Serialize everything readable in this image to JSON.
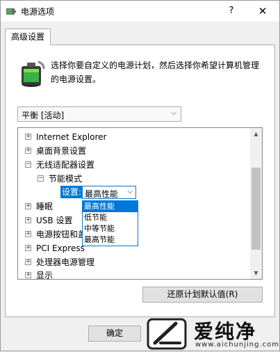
{
  "window": {
    "title": "电源选项",
    "help_label": "?",
    "close_label": "✕",
    "icon": "power-options-icon"
  },
  "tab": {
    "label": "高级设置"
  },
  "description": {
    "line1": "选择你要自定义的电源计划，然后选择你希望计算机管理",
    "line2": "的电源设置。"
  },
  "plan_select": {
    "value": "平衡 [活动]",
    "chevron": "⌵"
  },
  "tree": {
    "items": [
      {
        "expander": "+",
        "label": "Internet Explorer"
      },
      {
        "expander": "+",
        "label": "桌面背景设置"
      },
      {
        "expander": "−",
        "label": "无线适配器设置"
      },
      {
        "expander": "−",
        "label": "节能模式"
      },
      {
        "expander": "+",
        "label": "睡眠"
      },
      {
        "expander": "+",
        "label": "USB 设置"
      },
      {
        "expander": "+",
        "label": "电源按钮和盖"
      },
      {
        "expander": "+",
        "label": "PCI Express"
      },
      {
        "expander": "+",
        "label": "处理器电源管理"
      },
      {
        "expander": "+",
        "label": "显示"
      }
    ],
    "setting_label": "设置:",
    "setting_value": "最高性能",
    "setting_chevron": "⌵"
  },
  "dropdown": {
    "options": [
      "最高性能",
      "低节能",
      "中等节能",
      "最高节能"
    ],
    "selected_index": 0
  },
  "scrollbar": {
    "up": "▲",
    "down": "▼"
  },
  "buttons": {
    "restore": "还原计划默认值(R)",
    "ok": "确定"
  },
  "watermark": {
    "name": "爱纯净",
    "url": "www.aichunjing.com"
  },
  "colors": {
    "accent": "#0078d7",
    "battery_green": "#3cb043"
  }
}
